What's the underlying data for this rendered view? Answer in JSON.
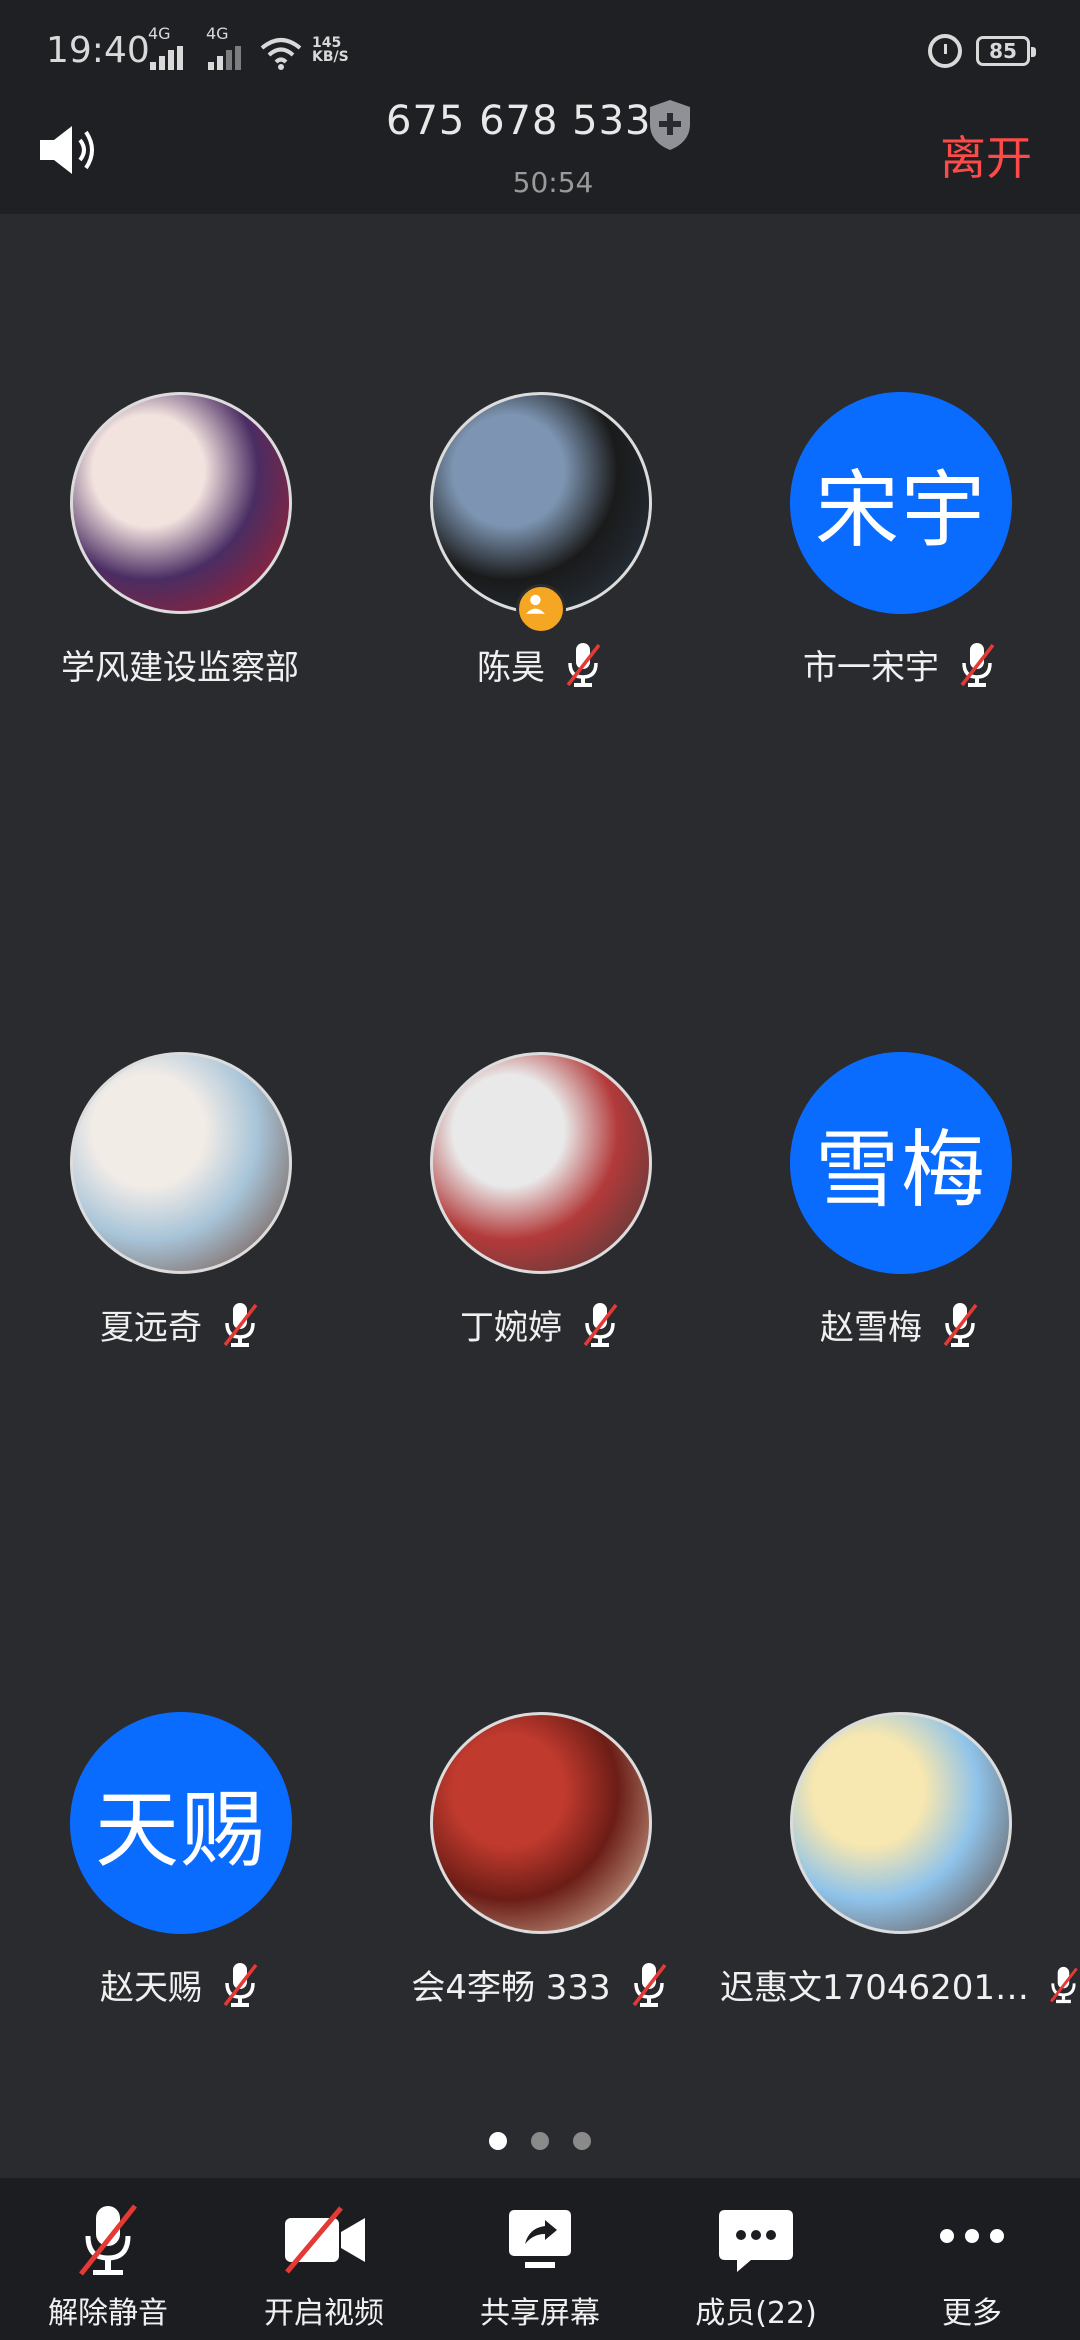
{
  "status_bar": {
    "time": "19:40",
    "net1": "4G",
    "net2": "4G",
    "speed_value": "145",
    "speed_unit": "KB/S",
    "battery": "85"
  },
  "header": {
    "meeting_id": "675 678 533",
    "duration": "50:54",
    "leave_label": "离开"
  },
  "participants": [
    {
      "name": "学风建设监察部",
      "avatar_type": "image",
      "avatar_colors": [
        "#f3e3df",
        "#b81c20",
        "#4a2d63"
      ],
      "muted": false,
      "host": false
    },
    {
      "name": "陈昊",
      "avatar_type": "image",
      "avatar_colors": [
        "#7d95b2",
        "#2b3a4a",
        "#1a1a1a"
      ],
      "muted": true,
      "host": true
    },
    {
      "name": "市一宋宇",
      "avatar_type": "text",
      "avatar_text": "宋宇",
      "muted": true,
      "host": false
    },
    {
      "name": "夏远奇",
      "avatar_type": "image",
      "avatar_colors": [
        "#f2ece7",
        "#6b3c2a",
        "#a7c4d8"
      ],
      "muted": true,
      "host": false
    },
    {
      "name": "丁婉婷",
      "avatar_type": "image",
      "avatar_colors": [
        "#e9e9e9",
        "#3a3a3a",
        "#b33a3a"
      ],
      "muted": true,
      "host": false
    },
    {
      "name": "赵雪梅",
      "avatar_type": "text",
      "avatar_text": "雪梅",
      "muted": true,
      "host": false
    },
    {
      "name": "赵天赐",
      "avatar_type": "text",
      "avatar_text": "天赐",
      "muted": true,
      "host": false
    },
    {
      "name": "会4李畅 333",
      "avatar_type": "image",
      "avatar_colors": [
        "#c13a2e",
        "#e9d2b8",
        "#6b1d16"
      ],
      "muted": true,
      "host": false
    },
    {
      "name": "迟惠文17046201…",
      "avatar_type": "image",
      "avatar_colors": [
        "#f7e7b0",
        "#5b3a2a",
        "#8fc3ea"
      ],
      "muted": true,
      "host": false
    }
  ],
  "pager": {
    "count": 3,
    "active": 0
  },
  "toolbar": {
    "unmute": "解除静音",
    "start_video": "开启视频",
    "share_screen": "共享屏幕",
    "members": "成员(22)",
    "more": "更多"
  },
  "colors": {
    "accent_blue": "#0a6cff",
    "leave_red": "#ff4a4a",
    "mute_red": "#e53935",
    "host_badge": "#f5a623"
  }
}
